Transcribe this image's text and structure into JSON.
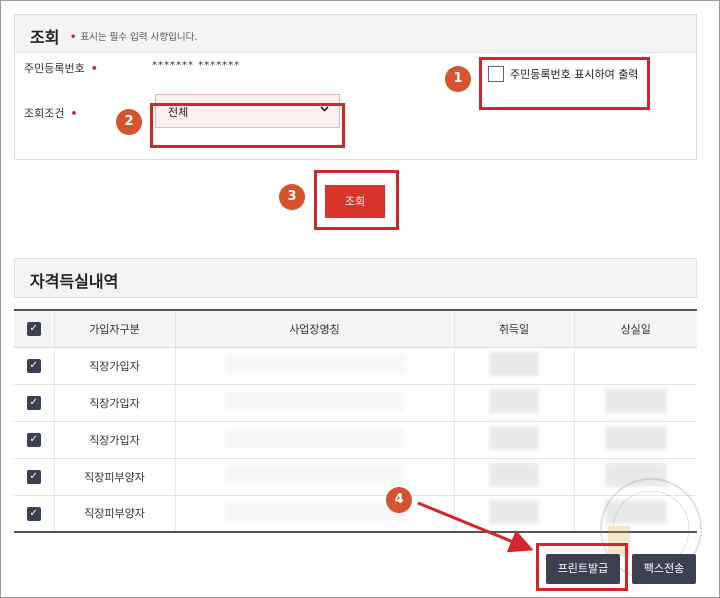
{
  "search": {
    "title": "조회",
    "required_mark": "•",
    "note": "표시는 필수 입력 사항입니다.",
    "rrn_label": "주민등록번호",
    "rrn_value": "*******  *******",
    "show_rrn_label": "주민등록번호 표시하여 출력",
    "condition_label": "조회조건",
    "condition_selected": "전체",
    "search_button": "조회"
  },
  "results": {
    "title": "자격득실내역",
    "columns": [
      "가입자구분",
      "사업장명칭",
      "취득일",
      "상실일"
    ],
    "rows": [
      {
        "type": "직장가입자",
        "lost_blurred": false
      },
      {
        "type": "직장가입자",
        "lost_blurred": true
      },
      {
        "type": "직장가입자",
        "lost_blurred": true
      },
      {
        "type": "직장피부양자",
        "lost_blurred": true
      },
      {
        "type": "직장피부양자",
        "lost_blurred": true
      }
    ]
  },
  "actions": {
    "print_button": "프린트발급",
    "fax_button": "팩스전송"
  },
  "callouts": [
    "1",
    "2",
    "3",
    "4"
  ],
  "colors": {
    "highlight": "#d3262b",
    "badge": "#d5542e",
    "search_button": "#d9332b",
    "dark_button": "#3c4152"
  }
}
